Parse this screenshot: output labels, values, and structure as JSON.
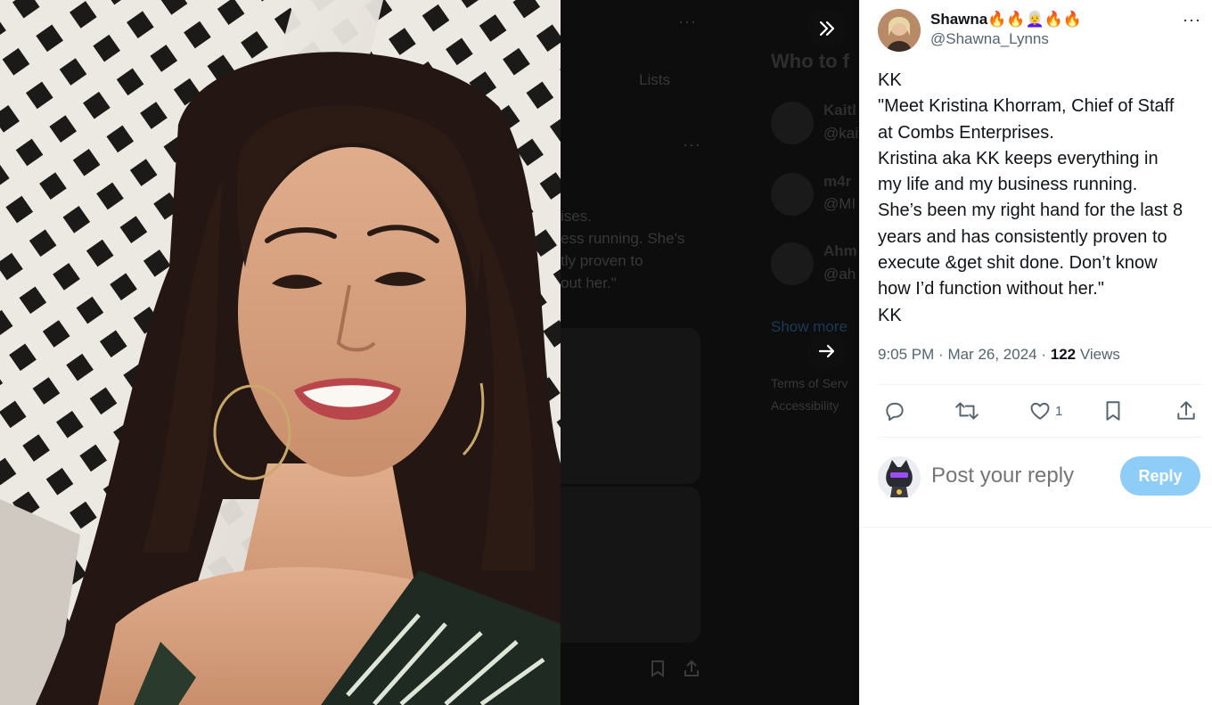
{
  "background": {
    "lists_label": "Lists",
    "who_to_follow": "Who to f",
    "suggestions": [
      {
        "name": "Kaitl",
        "handle": "@kai"
      },
      {
        "name": "m4r",
        "handle": "@MI"
      },
      {
        "name": "Ahm",
        "handle": "@ah"
      }
    ],
    "show_more": "Show more",
    "tweet_fragments": [
      "ises.",
      "ess running. She's",
      "tly proven to",
      "out her.\""
    ],
    "footer_lines": [
      "Terms of Serv",
      "Accessibility"
    ]
  },
  "tweet": {
    "author_name": "Shawna🔥🔥👩‍🦳🔥🔥",
    "author_handle": "@Shawna_Lynns",
    "more_label": "···",
    "text_lines": [
      "KK",
      "\"Meet Kristina Khorram, Chief of Staff",
      "at Combs Enterprises.",
      "Kristina aka KK keeps everything in",
      "my life and my business running.",
      "She’s been my right hand for the last 8",
      "years and has consistently proven to",
      "execute &get shit done. Don’t know",
      "how I’d function without her.\"",
      "KK"
    ],
    "time": "9:05 PM",
    "date": "Mar 26, 2024",
    "views_count": "122",
    "views_label": "Views",
    "like_count": "1"
  },
  "reply": {
    "placeholder": "Post your reply",
    "button_label": "Reply"
  },
  "colors": {
    "accent": "#1d9bf0",
    "reply_button_disabled": "#8ecdf8",
    "muted_text": "#536471"
  },
  "icons": [
    "collapse-panel-icon",
    "next-image-icon",
    "reply-icon",
    "retweet-icon",
    "like-icon",
    "bookmark-icon",
    "share-icon"
  ]
}
